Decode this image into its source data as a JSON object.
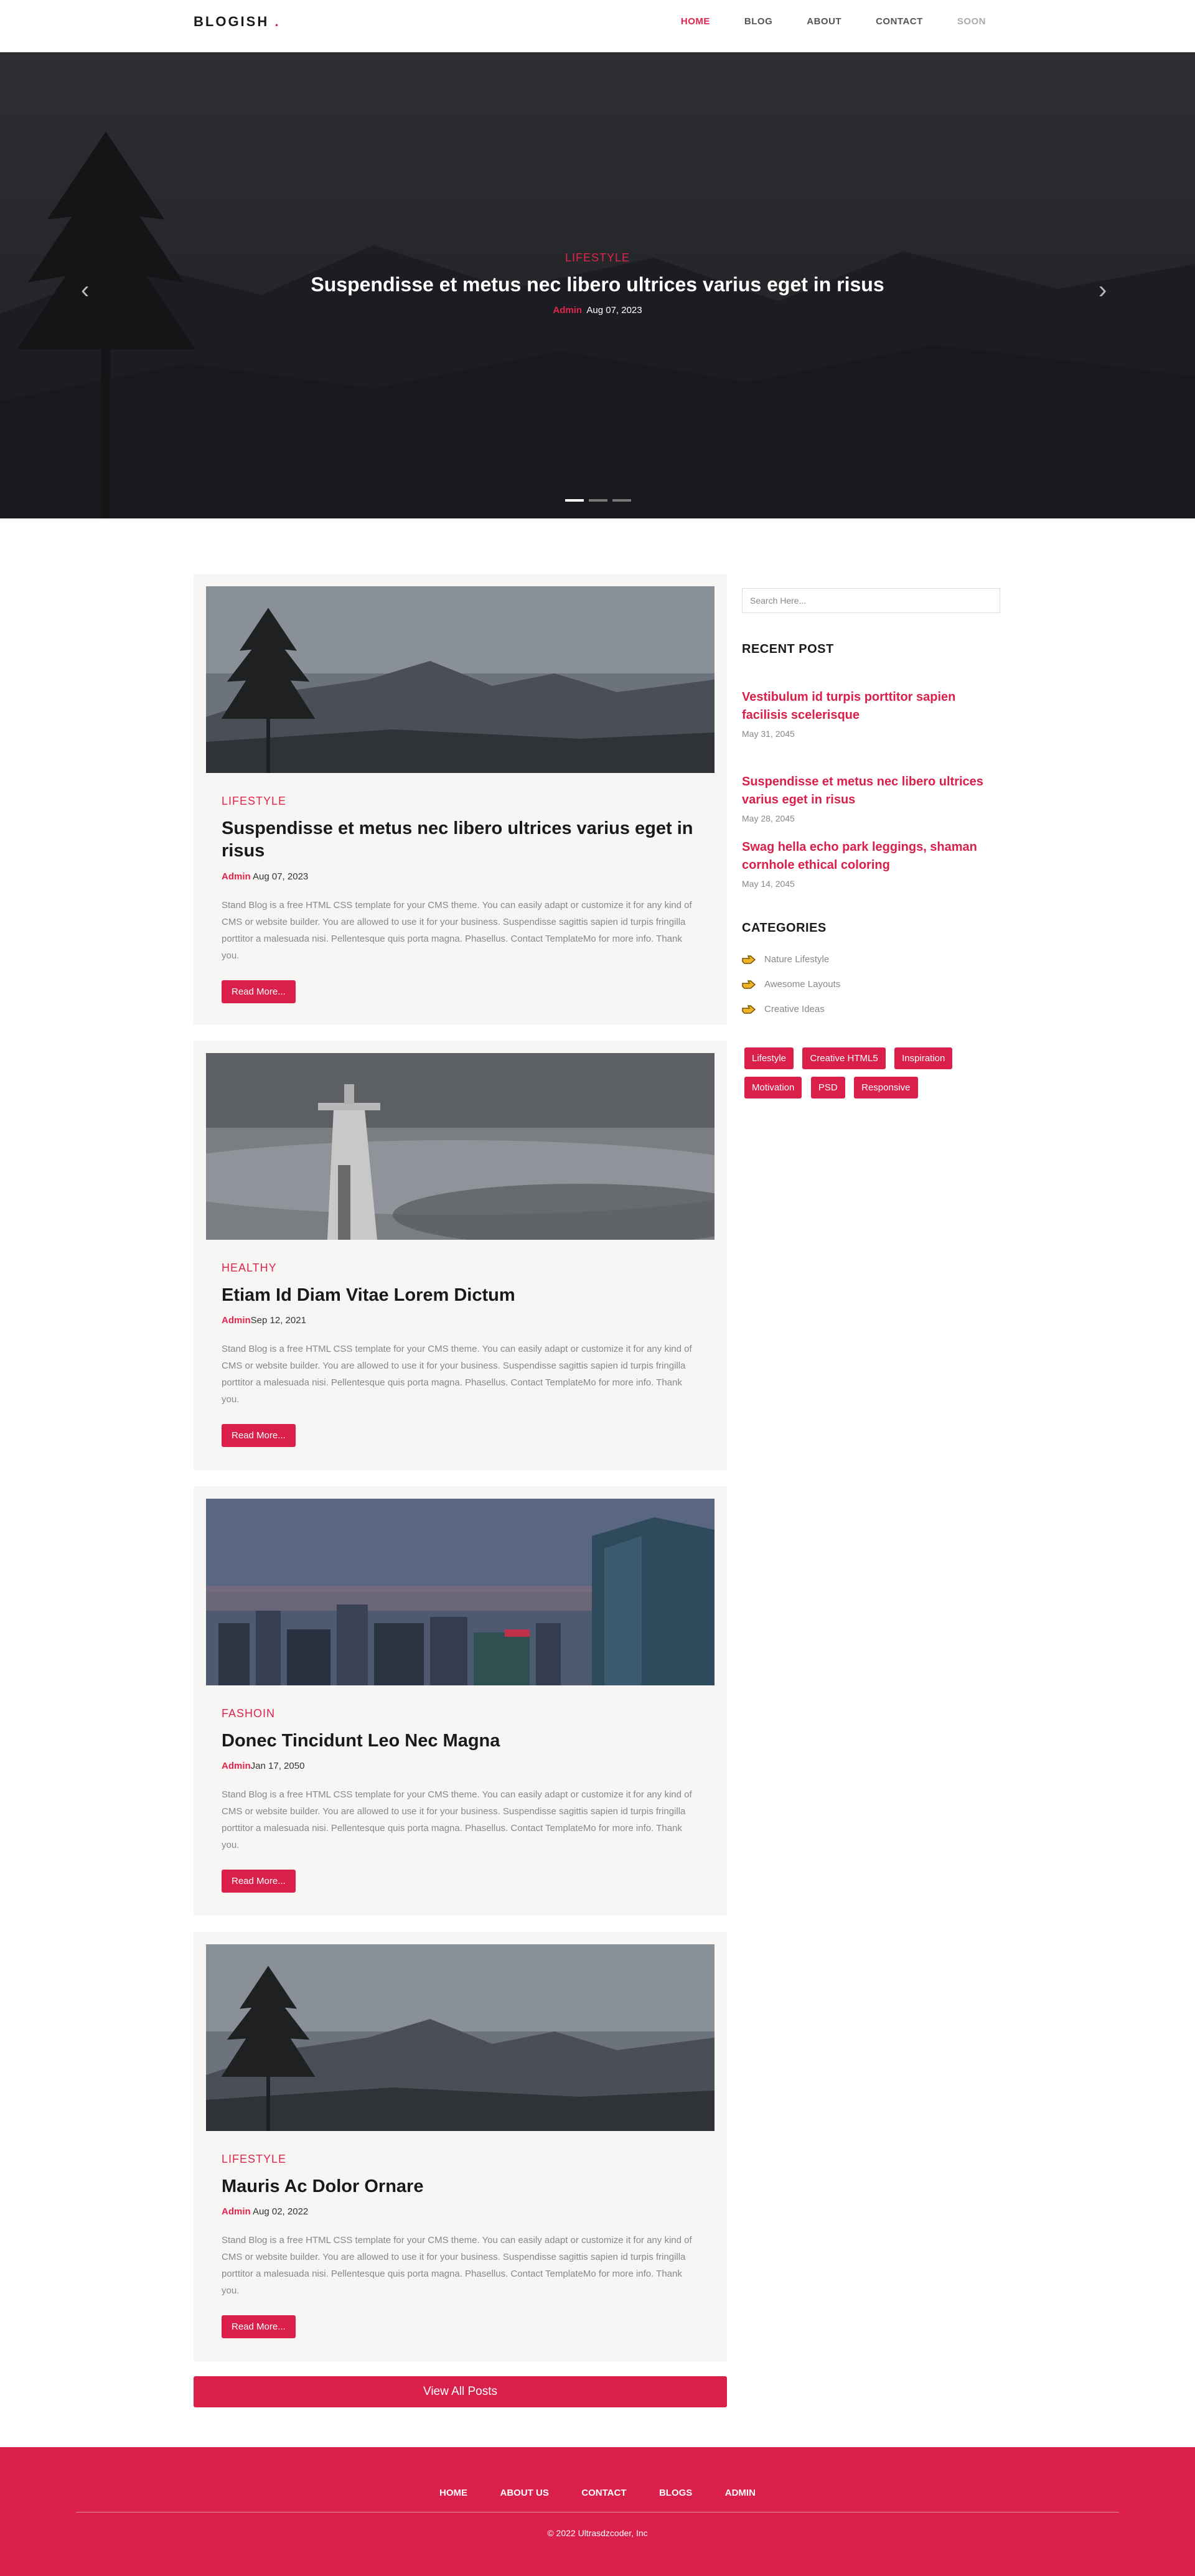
{
  "nav": {
    "logo": "BLOGISH",
    "logo_dot": ".",
    "links": [
      "HOME",
      "BLOG",
      "ABOUT",
      "CONTACT",
      "SOON"
    ]
  },
  "hero": {
    "category": "LIFESTYLE",
    "title": "Suspendisse et metus nec libero ultrices varius eget in risus",
    "author": "Admin",
    "date": "Aug 07, 2023",
    "prev_icon": "chevron-left-icon",
    "next_icon": "chevron-right-icon",
    "slides": 3,
    "active_slide": 1
  },
  "posts": [
    {
      "category": "LIFESTYLE",
      "title": "Suspendisse et metus nec libero ultrices varius eget in risus",
      "author": "Admin",
      "date": "Aug 07, 2023",
      "text": "Stand Blog is a free HTML CSS template for your CMS theme. You can easily adapt or customize it for any kind of CMS or website builder. You are allowed to use it for your business. Suspendisse sagittis sapien id turpis fringilla porttitor a malesuada nisi. Pellentesque quis porta magna. Phasellus. Contact TemplateMo for more info. Thank you.",
      "button": "Read More..."
    },
    {
      "category": "HEALTHY",
      "title": "Etiam Id Diam Vitae Lorem Dictum",
      "author": "Admin",
      "date": "Sep 12, 2021",
      "text": "Stand Blog is a free HTML CSS template for your CMS theme. You can easily adapt or customize it for any kind of CMS or website builder. You are allowed to use it for your business. Suspendisse sagittis sapien id turpis fringilla porttitor a malesuada nisi. Pellentesque quis porta magna. Phasellus. Contact TemplateMo for more info. Thank you.",
      "button": "Read More..."
    },
    {
      "category": "FASHOIN",
      "title": "Donec Tincidunt Leo Nec Magna",
      "author": "Admin",
      "date": "Jan 17, 2050",
      "text": "Stand Blog is a free HTML CSS template for your CMS theme. You can easily adapt or customize it for any kind of CMS or website builder. You are allowed to use it for your business. Suspendisse sagittis sapien id turpis fringilla porttitor a malesuada nisi. Pellentesque quis porta magna. Phasellus. Contact TemplateMo for more info. Thank you.",
      "button": "Read More..."
    },
    {
      "category": "LIFESTYLE",
      "title": "Mauris Ac Dolor Ornare",
      "author": "Admin",
      "date": "Aug 02, 2022",
      "text": "Stand Blog is a free HTML CSS template for your CMS theme. You can easily adapt or customize it for any kind of CMS or website builder. You are allowed to use it for your business. Suspendisse sagittis sapien id turpis fringilla porttitor a malesuada nisi. Pellentesque quis porta magna. Phasellus. Contact TemplateMo for more info. Thank you.",
      "button": "Read More..."
    }
  ],
  "view_all": "View All Posts",
  "sidebar": {
    "search_placeholder": "Search Here...",
    "recent_heading": "RECENT POST",
    "recent": [
      {
        "title": "Vestibulum id turpis porttitor sapien facilisis scelerisque",
        "date": "May 31, 2045"
      },
      {
        "title": "Suspendisse et metus nec libero ultrices varius eget in risus",
        "date": "May 28, 2045"
      },
      {
        "title": "Swag hella echo park leggings, shaman cornhole ethical coloring",
        "date": "May 14, 2045"
      }
    ],
    "categories_heading": "CATEGORIES",
    "categories": [
      "Nature Lifestyle",
      "Awesome Layouts",
      "Creative Ideas"
    ],
    "category_icon": "pointing-hand-icon",
    "tags": [
      "Lifestyle",
      "Creative HTML5",
      "Inspiration",
      "Motivation",
      "PSD",
      "Responsive"
    ]
  },
  "footer": {
    "links": [
      "HOME",
      "ABOUT US",
      "CONTACT",
      "BLOGS",
      "ADMIN"
    ],
    "copyright": "© 2022 Ultrasdzcoder, Inc"
  },
  "colors": {
    "accent": "#d91f4a",
    "hero_bg": "#26272b",
    "card_bg": "#f7f6f4"
  }
}
